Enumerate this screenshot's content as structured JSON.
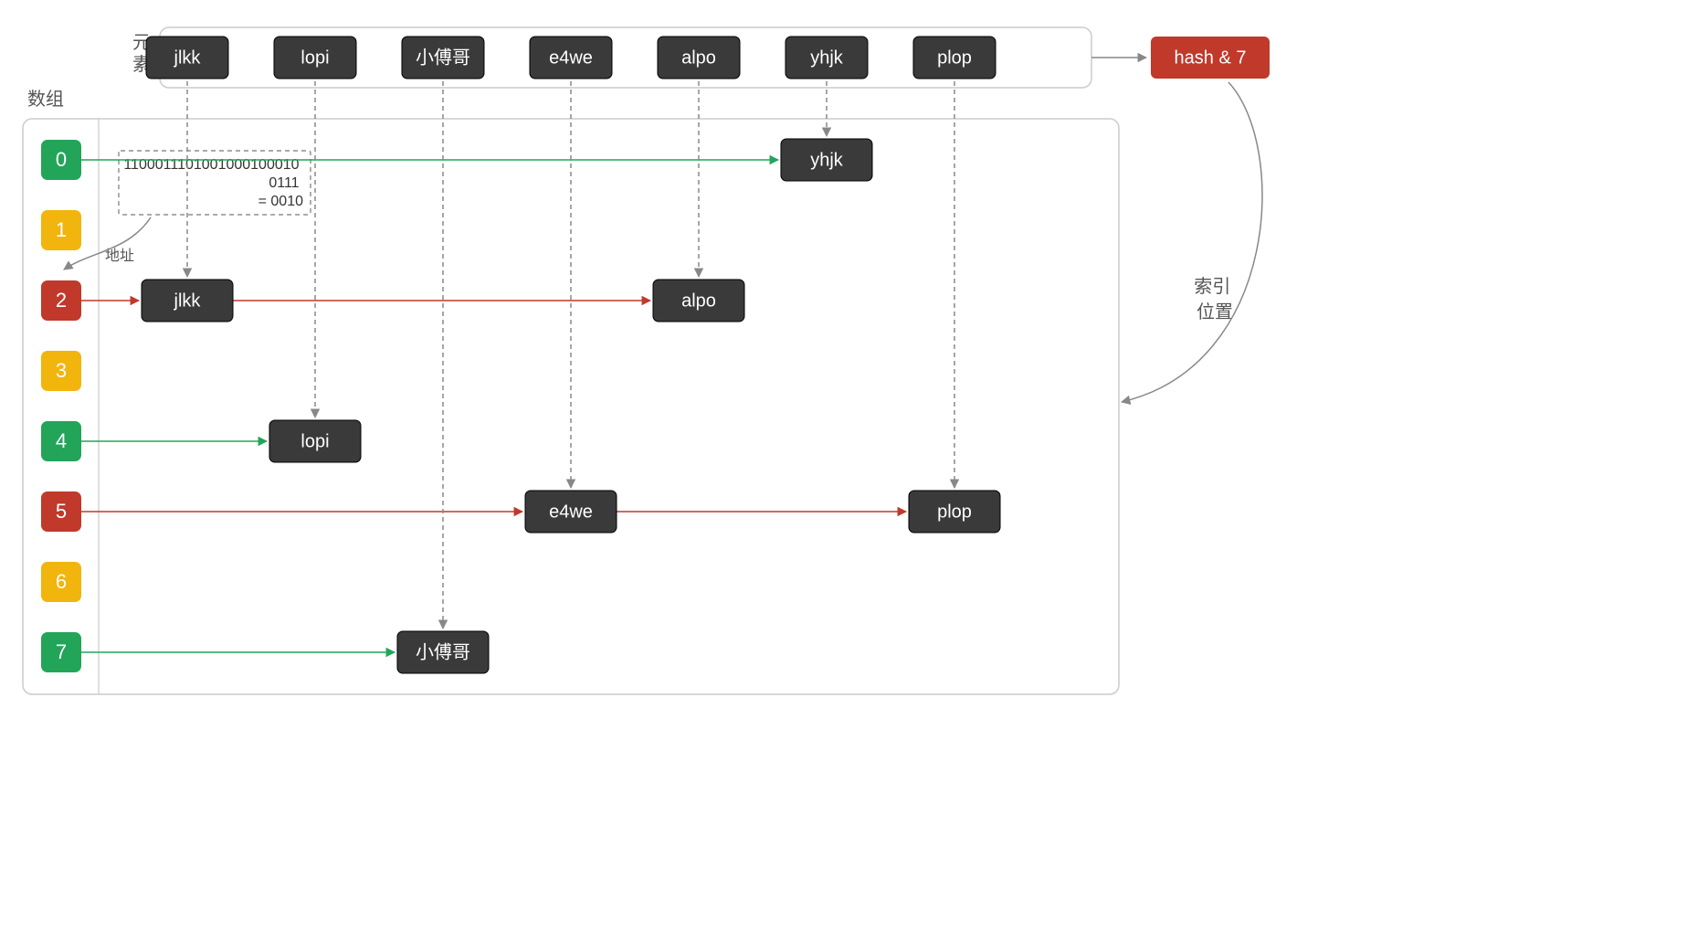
{
  "labels": {
    "elements": "元\n素",
    "array": "数组",
    "hash": "hash & 7",
    "index_pos": "索引\n位置",
    "address": "地址"
  },
  "elements": [
    "jlkk",
    "lopi",
    "小傅哥",
    "e4we",
    "alpo",
    "yhjk",
    "plop"
  ],
  "indices": [
    {
      "n": "0",
      "color": "#22a559"
    },
    {
      "n": "1",
      "color": "#f1b50e"
    },
    {
      "n": "2",
      "color": "#c0392b"
    },
    {
      "n": "3",
      "color": "#f1b50e"
    },
    {
      "n": "4",
      "color": "#22a559"
    },
    {
      "n": "5",
      "color": "#c0392b"
    },
    {
      "n": "6",
      "color": "#f1b50e"
    },
    {
      "n": "7",
      "color": "#22a559"
    }
  ],
  "buckets": {
    "0": [
      {
        "label": "yhjk",
        "col": 5
      }
    ],
    "2": [
      {
        "label": "jlkk",
        "col": 0
      },
      {
        "label": "alpo",
        "col": 4
      }
    ],
    "4": [
      {
        "label": "lopi",
        "col": 1
      }
    ],
    "5": [
      {
        "label": "e4we",
        "col": 3
      },
      {
        "label": "plop",
        "col": 6
      }
    ],
    "7": [
      {
        "label": "小傅哥",
        "col": 2
      }
    ]
  },
  "binary": {
    "line1": "1100011101001000100010",
    "line2": "0111",
    "line3": "= 0010"
  }
}
